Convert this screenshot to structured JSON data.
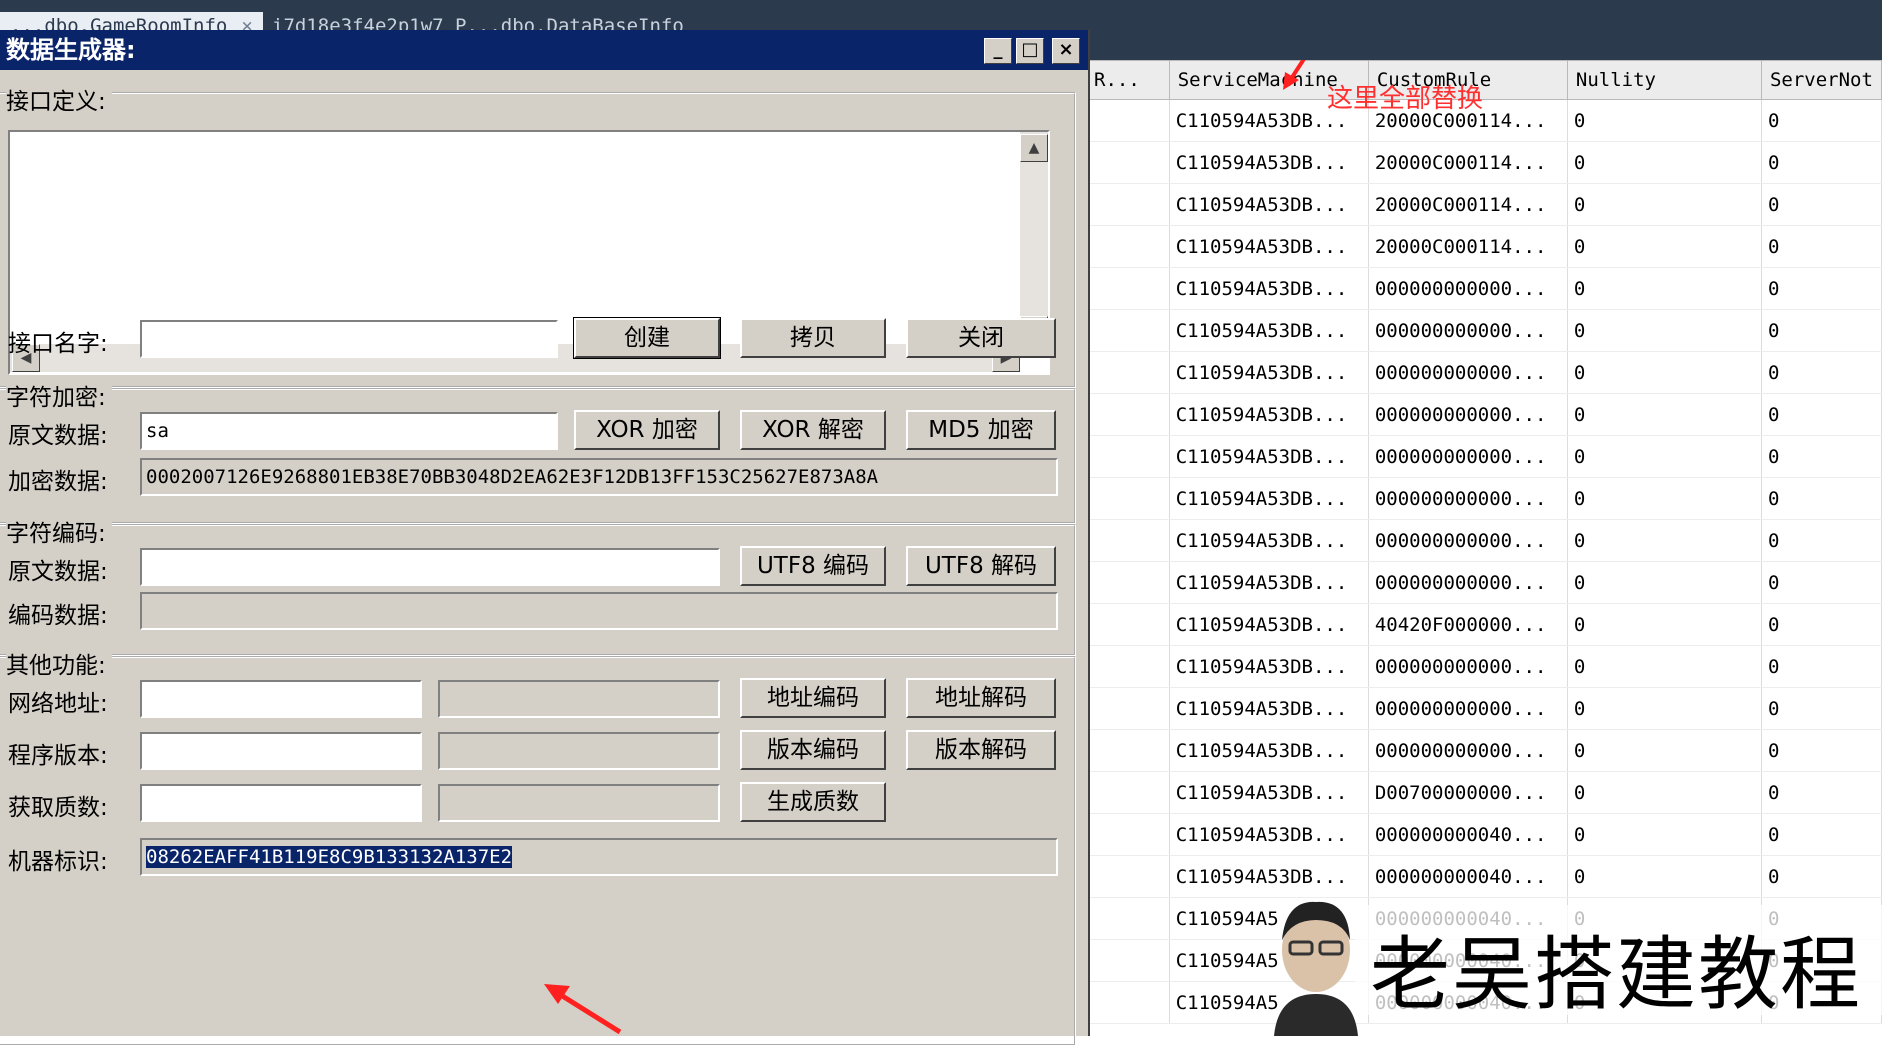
{
  "tabs": [
    {
      "label": "...dbo.GameRoomInfo",
      "close": "×"
    },
    {
      "label": "i7d18e3f4e2p1w7 P...dbo.DataBaseInfo"
    }
  ],
  "dialog": {
    "title": "数据生成器:",
    "minimize": "_",
    "maximize": "□",
    "close": "×",
    "interface_group": {
      "label": "接口定义:",
      "textarea_value": "",
      "name_label": "接口名字:",
      "name_value": "",
      "create_button": "创建",
      "copy_button": "拷贝",
      "close_button": "关闭"
    },
    "encrypt_group": {
      "label": "字符加密:",
      "source_label": "原文数据:",
      "source_value": "sa",
      "xor_encrypt_button": "XOR 加密",
      "xor_decrypt_button": "XOR 解密",
      "md5_button": "MD5 加密",
      "encrypted_label": "加密数据:",
      "encrypted_value": "0002007126E9268801EB38E70BB3048D2EA62E3F12DB13FF153C25627E873A8A"
    },
    "encode_group": {
      "label": "字符编码:",
      "source_label": "原文数据:",
      "source_value": "",
      "utf8_encode_button": "UTF8 编码",
      "utf8_decode_button": "UTF8 解码",
      "encoded_label": "编码数据:",
      "encoded_value": ""
    },
    "other_group": {
      "label": "其他功能:",
      "net_label": "网络地址:",
      "addr_encode_button": "地址编码",
      "addr_decode_button": "地址解码",
      "version_label": "程序版本:",
      "ver_encode_button": "版本编码",
      "ver_decode_button": "版本解码",
      "prime_label": "获取质数:",
      "prime_button": "生成质数",
      "machine_label": "机器标识:",
      "machine_value": "08262EAFF41B119E8C9B133132A137E2"
    }
  },
  "grid": {
    "annotation": "这里全部替换",
    "columns": [
      "R...",
      "ServiceMachine",
      "CustomRule",
      "Nullity",
      "ServerNot"
    ],
    "rows": [
      [
        "",
        "C110594A53DB...",
        "20000C000114...",
        "0",
        "0"
      ],
      [
        "",
        "C110594A53DB...",
        "20000C000114...",
        "0",
        "0"
      ],
      [
        "",
        "C110594A53DB...",
        "20000C000114...",
        "0",
        "0"
      ],
      [
        "",
        "C110594A53DB...",
        "20000C000114...",
        "0",
        "0"
      ],
      [
        "",
        "C110594A53DB...",
        "000000000000...",
        "0",
        "0"
      ],
      [
        "",
        "C110594A53DB...",
        "000000000000...",
        "0",
        "0"
      ],
      [
        "",
        "C110594A53DB...",
        "000000000000...",
        "0",
        "0"
      ],
      [
        "",
        "C110594A53DB...",
        "000000000000...",
        "0",
        "0"
      ],
      [
        "",
        "C110594A53DB...",
        "000000000000...",
        "0",
        "0"
      ],
      [
        "",
        "C110594A53DB...",
        "000000000000...",
        "0",
        "0"
      ],
      [
        "",
        "C110594A53DB...",
        "000000000000...",
        "0",
        "0"
      ],
      [
        "",
        "C110594A53DB...",
        "000000000000...",
        "0",
        "0"
      ],
      [
        "",
        "C110594A53DB...",
        "40420F000000...",
        "0",
        "0"
      ],
      [
        "",
        "C110594A53DB...",
        "000000000000...",
        "0",
        "0"
      ],
      [
        "",
        "C110594A53DB...",
        "000000000000...",
        "0",
        "0"
      ],
      [
        "",
        "C110594A53DB...",
        "000000000000...",
        "0",
        "0"
      ],
      [
        "",
        "C110594A53DB...",
        "D00700000000...",
        "0",
        "0"
      ],
      [
        "",
        "C110594A53DB...",
        "000000000040...",
        "0",
        "0"
      ],
      [
        "",
        "C110594A53DB...",
        "000000000040...",
        "0",
        "0"
      ],
      [
        "",
        "C110594A5",
        "000000000040...",
        "0",
        "0"
      ],
      [
        "",
        "C110594A5",
        "000000000040...",
        "0",
        "0"
      ],
      [
        "",
        "C110594A5",
        "000000000040...",
        "0",
        "0"
      ]
    ]
  },
  "watermark": {
    "text": "老吴搭建教程"
  },
  "colors": {
    "annotation": "#ff3030",
    "titlebar": "#0a246a",
    "dialog_bg": "#d4d0c8"
  }
}
